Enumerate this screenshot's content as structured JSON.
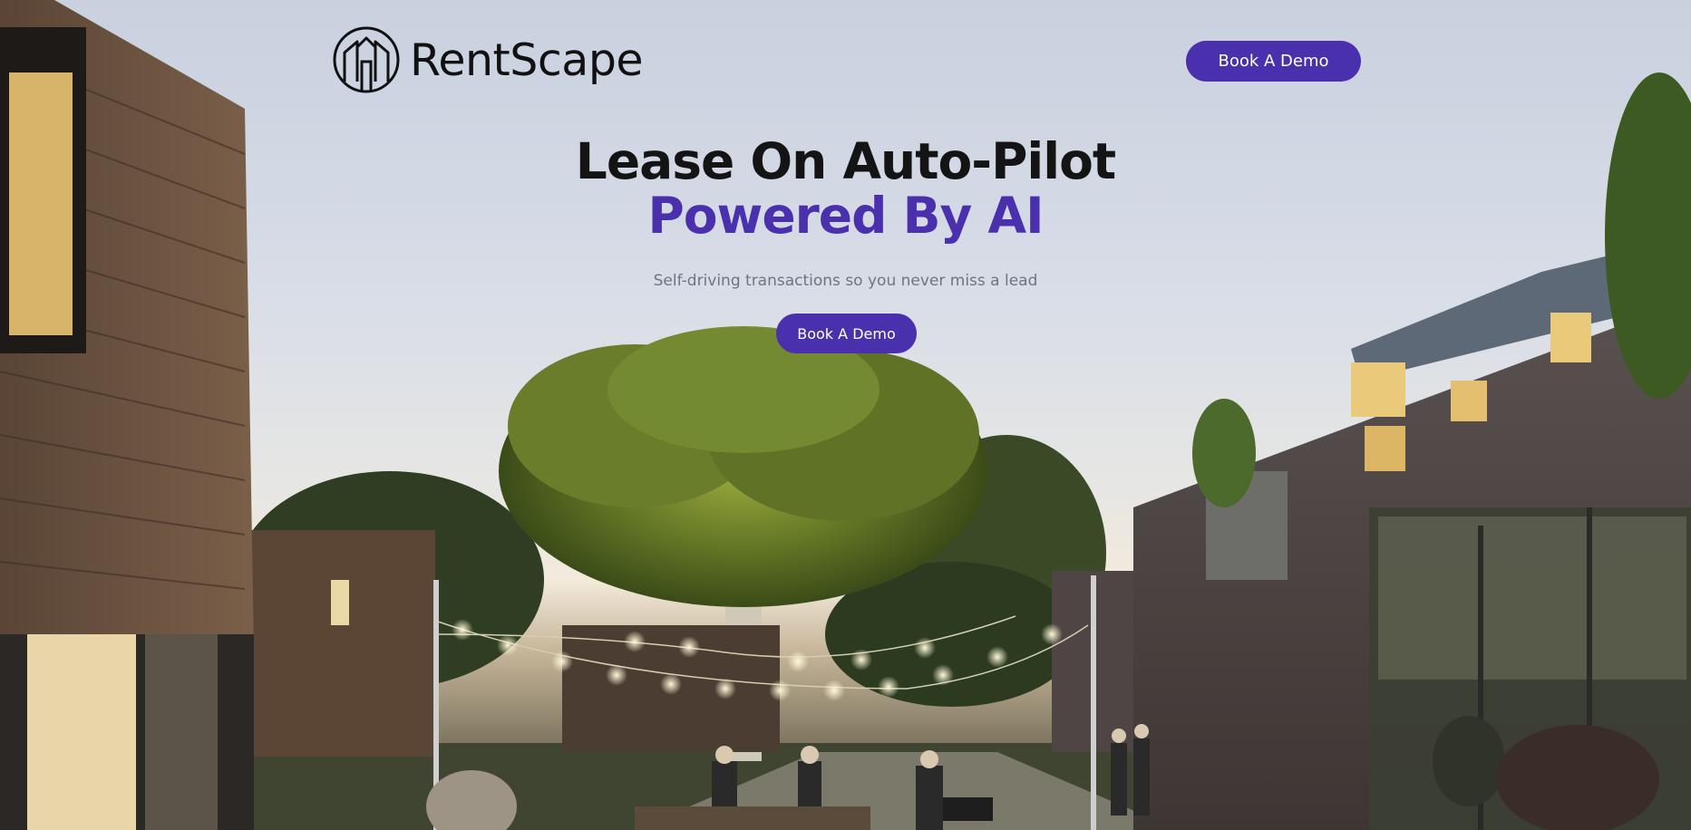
{
  "brand": {
    "name": "RentScape",
    "logo_icon": "house-arch-icon"
  },
  "header": {
    "demo_button_label": "Book A Demo"
  },
  "hero": {
    "title_line1": "Lease On Auto-Pilot",
    "title_line2": "Powered By AI",
    "subtitle": "Self-driving transactions so you never miss a lead",
    "cta_label": "Book A Demo"
  },
  "colors": {
    "accent": "#4b30ad",
    "title": "#141414",
    "subtitle": "#6f7480"
  }
}
